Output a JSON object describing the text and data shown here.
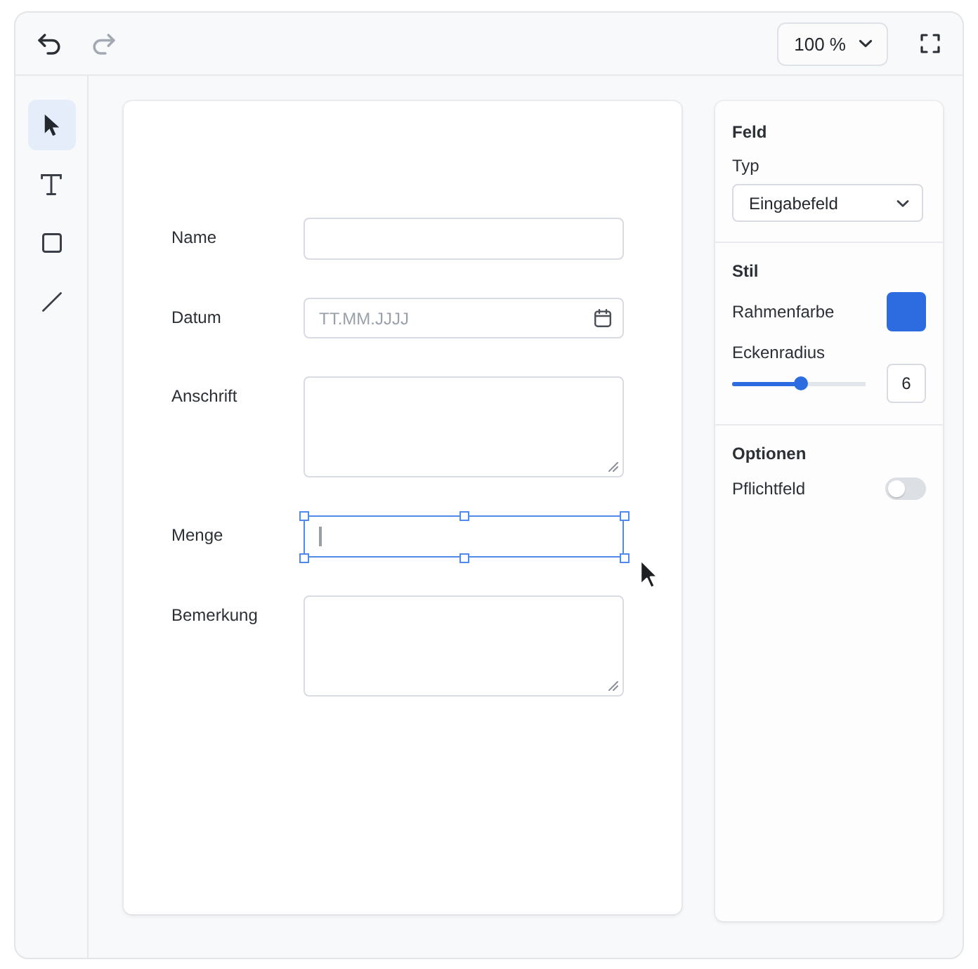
{
  "toolbar": {
    "history_buttons": [
      {
        "kind": "undo",
        "disabled": false
      },
      {
        "kind": "redo",
        "disabled": true
      }
    ],
    "zoom": "100 %"
  },
  "tools": [
    {
      "kind": "select",
      "selected": true
    },
    {
      "kind": "text",
      "selected": false
    },
    {
      "kind": "rectangle",
      "selected": false
    },
    {
      "kind": "line",
      "selected": false
    }
  ],
  "form": {
    "fields": [
      {
        "label": "Name",
        "kind": "text",
        "selected": false,
        "focused": false
      },
      {
        "label": "Datum",
        "kind": "date",
        "placeholder": "TT.MM.JJJJ",
        "selected": false,
        "focused": false
      },
      {
        "label": "Anschrift",
        "kind": "textarea",
        "selected": false,
        "focused": false
      },
      {
        "label": "Menge",
        "kind": "text",
        "selected": true,
        "focused": true
      },
      {
        "label": "Bemerkung",
        "kind": "textarea",
        "selected": false,
        "focused": false
      }
    ]
  },
  "properties": {
    "field": {
      "heading": "Feld",
      "type_label": "Typ",
      "type_value": "Eingabefeld"
    },
    "style": {
      "heading": "Stil",
      "border_color": {
        "label": "Rahmenfarbe",
        "color": "#2d6be0"
      },
      "corner_radius": {
        "label": "Eckenradius",
        "level": 0.52,
        "value": "6"
      }
    },
    "options": {
      "heading": "Optionen",
      "required": {
        "label": "Pflichtfeld",
        "on": false
      }
    }
  }
}
